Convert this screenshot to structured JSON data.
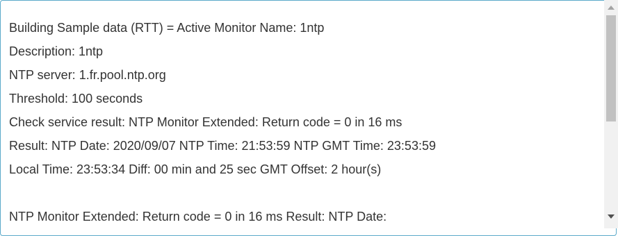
{
  "textarea": {
    "lines": [
      "Building Sample data (RTT) = Active Monitor Name: 1ntp",
      "Description: 1ntp",
      "NTP server: 1.fr.pool.ntp.org",
      "Threshold: 100 seconds",
      "Check service result: NTP Monitor Extended: Return code = 0 in 16 ms",
      "Result: NTP Date: 2020/09/07 NTP Time: 21:53:59 NTP GMT Time: 23:53:59",
      "Local Time: 23:53:34 Diff: 00 min and 25 sec GMT Offset: 2 hour(s)",
      "",
      "NTP Monitor Extended: Return code = 0 in 16 ms Result: NTP Date:"
    ]
  },
  "scrollbar": {
    "up_icon": "triangle-up-icon",
    "down_icon": "triangle-down-icon"
  },
  "colors": {
    "border": "#5aa9c9",
    "text": "#333333",
    "thumb": "#c1c1c1",
    "track": "#f1f1f1"
  }
}
